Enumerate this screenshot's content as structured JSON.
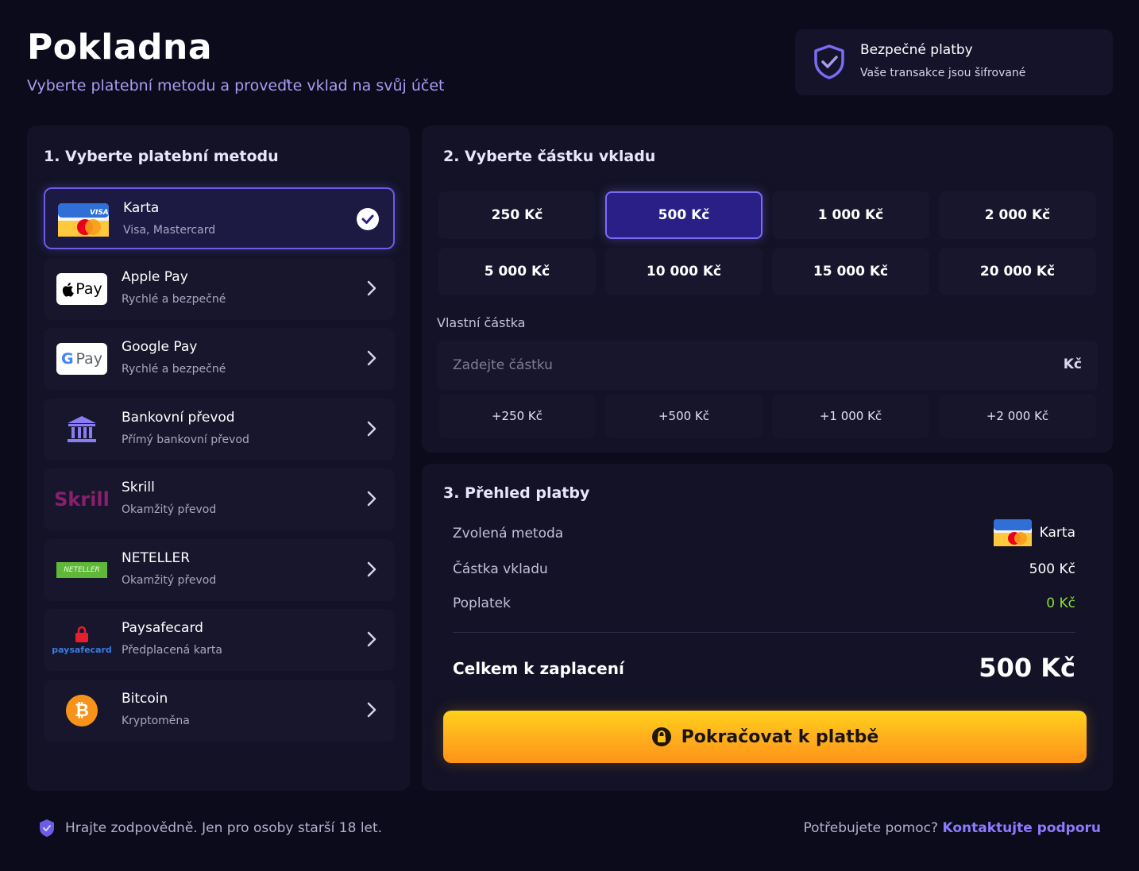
{
  "header": {
    "title": "Pokladna",
    "subtitle": "Vyberte platební metodu a proveďte vklad na svůj účet"
  },
  "secure": {
    "title": "Bezpečné platby",
    "subtitle": "Vaše transakce jsou šifrované",
    "icon": "shield-check-icon"
  },
  "methods_section": {
    "heading": "1. Vyberte platební metodu",
    "items": [
      {
        "name": "Karta",
        "desc": "Visa, Mastercard",
        "selected": true,
        "icon": "card-icon",
        "logo_text": "VISA"
      },
      {
        "name": "Apple Pay",
        "desc": "Rychlé a bezpečné",
        "icon": "apple-pay-icon",
        "logo_text": "Pay"
      },
      {
        "name": "Google Pay",
        "desc": "Rychlé a bezpečné",
        "icon": "google-pay-icon",
        "logo_text": "Pay"
      },
      {
        "name": "Bankovní převod",
        "desc": "Přímý bankovní převod",
        "icon": "bank-icon"
      },
      {
        "name": "Skrill",
        "desc": "Okamžitý převod",
        "icon": "skrill-icon",
        "logo_text": "Skrill"
      },
      {
        "name": "NETELLER",
        "desc": "Okamžitý převod",
        "icon": "neteller-icon",
        "logo_text": "NETELLER"
      },
      {
        "name": "Paysafecard",
        "desc": "Předplacená karta",
        "icon": "paysafecard-icon",
        "logo_text": "paysafecard"
      },
      {
        "name": "Bitcoin",
        "desc": "Kryptoměna",
        "icon": "bitcoin-icon",
        "logo_text": "₿"
      }
    ]
  },
  "amount_section": {
    "heading": "2. Vyberte částku vkladu",
    "amounts": [
      "250 Kč",
      "500 Kč",
      "1 000 Kč",
      "2 000 Kč",
      "5 000 Kč",
      "10 000 Kč",
      "15 000 Kč",
      "20 000 Kč"
    ],
    "selected_amount": "500 Kč",
    "custom_label": "Vlastní částka",
    "custom_placeholder": "Zadejte částku",
    "currency": "Kč",
    "quick_add": [
      "+250 Kč",
      "+500 Kč",
      "+1 000 Kč",
      "+2 000 Kč"
    ]
  },
  "summary": {
    "heading": "3. Přehled platby",
    "method_label": "Zvolená metoda",
    "method_value": "Karta",
    "amount_label": "Částka vkladu",
    "amount_value": "500 Kč",
    "fee_label": "Poplatek",
    "fee_value": "0 Kč",
    "total_label": "Celkem k zaplacení",
    "total_value": "500 Kč",
    "pay_button": "Pokračovat k platbě"
  },
  "footer": {
    "responsible": "Hrajte zodpovědně. Jen pro osoby starší 18 let.",
    "help_text": "Potřebujete pomoc?",
    "help_link": "Kontaktujte podporu"
  },
  "colors": {
    "background": "#0c0b1c",
    "panel": "#131226",
    "accent": "#6c5ce7",
    "cta": "#ffb01e",
    "fee_green": "#8fdc3a",
    "link": "#8c7bff"
  }
}
